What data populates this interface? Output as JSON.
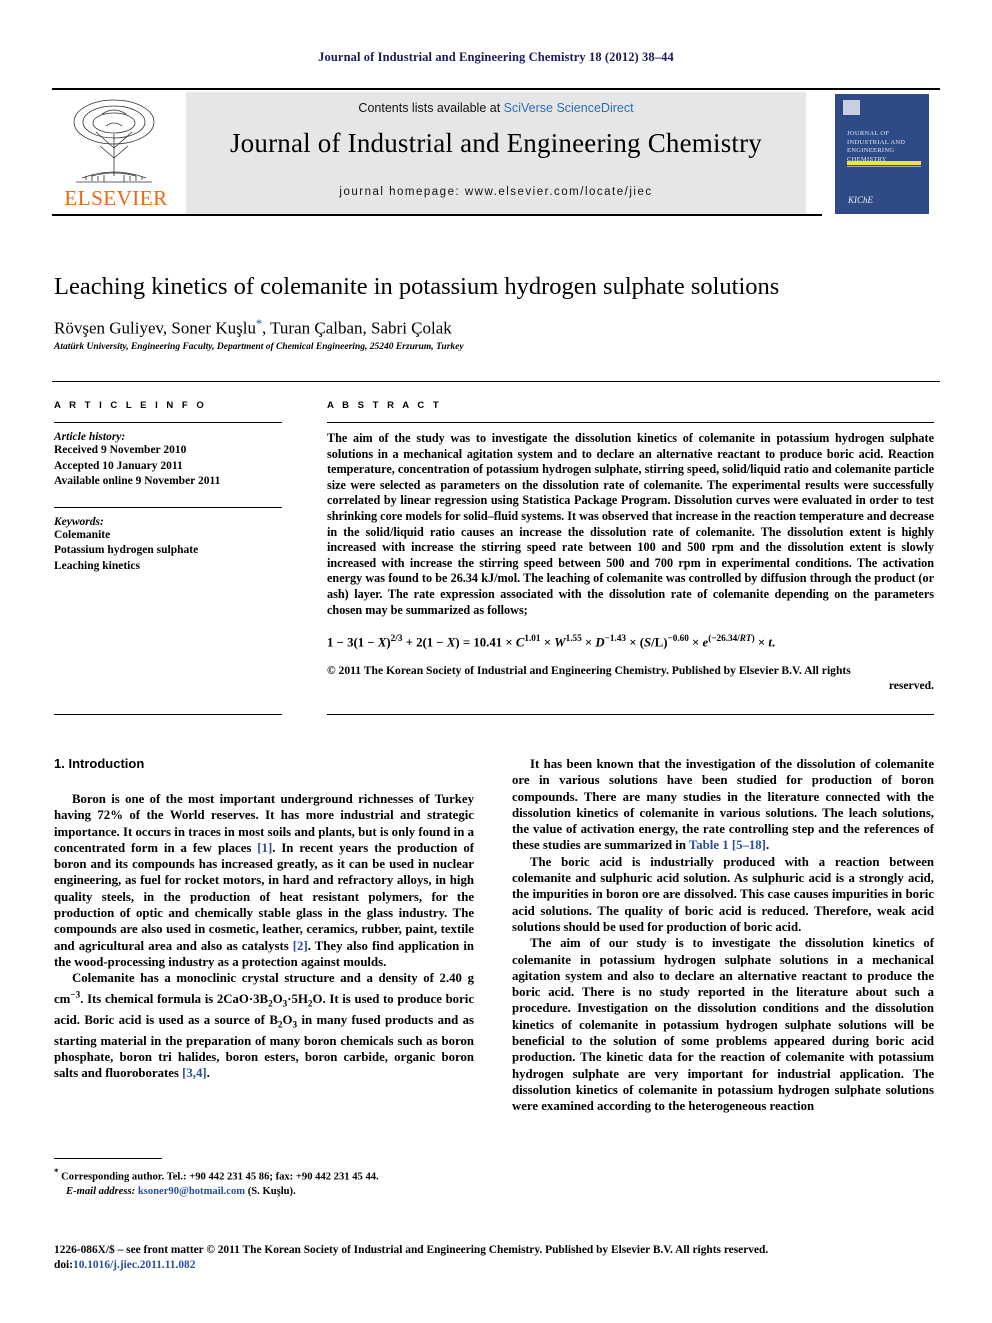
{
  "running_head": "Journal of Industrial and Engineering Chemistry 18 (2012) 38–44",
  "masthead": {
    "contents_prefix": "Contents lists available at ",
    "contents_link": "SciVerse ScienceDirect",
    "journal_name": "Journal of Industrial and Engineering Chemistry",
    "homepage": "journal homepage: www.elsevier.com/locate/jiec",
    "publisher_wordmark": "ELSEVIER",
    "cover_title": "Journal of Industrial and Engineering Chemistry",
    "cover_society": "The Korean Society of Industrial and Engineering Chemistry",
    "cover_society_mark": "KIChE"
  },
  "article": {
    "title": "Leaching kinetics of colemanite in potassium hydrogen sulphate solutions",
    "authors": "Rövşen Guliyev, Soner Kuşlu",
    "authors_tail": ", Turan Çalban, Sabri Çolak",
    "corresponding_marker": "*",
    "affiliation": "Atatürk University, Engineering Faculty, Department of Chemical Engineering, 25240 Erzurum, Turkey"
  },
  "article_info": {
    "heading": "A R T I C L E   I N F O",
    "history_label": "Article history:",
    "history": [
      "Received 9 November 2010",
      "Accepted 10 January 2011",
      "Available online 9 November 2011"
    ],
    "keywords_label": "Keywords:",
    "keywords": [
      "Colemanite",
      "Potassium hydrogen sulphate",
      "Leaching kinetics"
    ]
  },
  "abstract": {
    "heading": "A B S T R A C T",
    "text": "The aim of the study was to investigate the dissolution kinetics of colemanite in potassium hydrogen sulphate solutions in a mechanical agitation system and to declare an alternative reactant to produce boric acid. Reaction temperature, concentration of potassium hydrogen sulphate, stirring speed, solid/liquid ratio and colemanite particle size were selected as parameters on the dissolution rate of colemanite. The experimental results were successfully correlated by linear regression using Statistica Package Program. Dissolution curves were evaluated in order to test shrinking core models for solid–fluid systems. It was observed that increase in the reaction temperature and decrease in the solid/liquid ratio causes an increase the dissolution rate of colemanite. The dissolution extent is highly increased with increase the stirring speed rate between 100 and 500 rpm and the dissolution extent is slowly increased with increase the stirring speed between 500 and 700 rpm in experimental conditions. The activation energy was found to be 26.34 kJ/mol. The leaching of colemanite was controlled by diffusion through the product (or ash) layer. The rate expression associated with the dissolution rate of colemanite depending on the parameters chosen may be summarized as follows;",
    "equation_plain": "1 − 3(1 − X)2/3 + 2(1 − X) = 10.41 × C1.01 × W1.55 × D−1.43 × (S/L)−0.60 × e(−26.34/RT) × t.",
    "copyright": "© 2011 The Korean Society of Industrial and Engineering Chemistry. Published by Elsevier B.V. All rights",
    "copyright_tail": "reserved."
  },
  "body": {
    "intro_heading": "1. Introduction",
    "left_paragraphs": [
      "Boron is one of the most important underground richnesses of Turkey having 72% of the World reserves. It has more industrial and strategic importance. It occurs in traces in most soils and plants, but is only found in a concentrated form in a few places [1]. In recent years the production of boron and its compounds has increased greatly, as it can be used in nuclear engineering, as fuel for rocket motors, in hard and refractory alloys, in high quality steels, in the production of heat resistant polymers, for the production of optic and chemically stable glass in the glass industry. The compounds are also used in cosmetic, leather, ceramics, rubber, paint, textile and agricultural area and also as catalysts [2]. They also find application in the wood-processing industry as a protection against moulds.",
      "Colemanite has a monoclinic crystal structure and a density of 2.40 g cm−3. Its chemical formula is 2CaO·3B2O3·5H2O. It is used to produce boric acid. Boric acid is used as a source of B2O3 in many fused products and as starting material in the preparation of many boron chemicals such as boron phosphate, boron tri halides, boron esters, boron carbide, organic boron salts and fluoroborates [3,4]."
    ],
    "right_paragraphs": [
      "It has been known that the investigation of the dissolution of colemanite ore in various solutions have been studied for production of boron compounds. There are many studies in the literature connected with the dissolution kinetics of colemanite in various solutions. The leach solutions, the value of activation energy, the rate controlling step and the references of these studies are summarized in Table 1 [5–18].",
      "The boric acid is industrially produced with a reaction between colemanite and sulphuric acid solution. As sulphuric acid is a strongly acid, the impurities in boron ore are dissolved. This case causes impurities in boric acid solutions. The quality of boric acid is reduced. Therefore, weak acid solutions should be used for production of boric acid.",
      "The aim of our study is to investigate the dissolution kinetics of colemanite in potassium hydrogen sulphate solutions in a mechanical agitation system and also to declare an alternative reactant to produce the boric acid. There is no study reported in the literature about such a procedure. Investigation on the dissolution conditions and the dissolution kinetics of colemanite in potassium hydrogen sulphate solutions will be beneficial to the solution of some problems appeared during boric acid production. The kinetic data for the reaction of colemanite with potassium hydrogen sulphate are very important for industrial application. The dissolution kinetics of colemanite in potassium hydrogen sulphate solutions were examined according to the heterogeneous reaction"
    ]
  },
  "footnote": {
    "line1": "Corresponding author. Tel.: +90 442 231 45 86; fax: +90 442 231 45 44.",
    "email_label": "E-mail address:",
    "email": "ksoner90@hotmail.com",
    "email_owner": "(S. Kuşlu)."
  },
  "page_footer": {
    "line1": "1226-086X/$ – see front matter © 2011 The Korean Society of Industrial and Engineering Chemistry. Published by Elsevier B.V. All rights reserved.",
    "doi_label": "doi:",
    "doi": "10.1016/j.jiec.2011.11.082"
  },
  "colors": {
    "running_head": "#1b1b5c",
    "link": "#2a4d9b",
    "sciencedirect_link": "#2a6ebb",
    "elsevier_orange": "#e86a10",
    "cover_blue": "#2e4b86",
    "cover_yellow": "#f2e33c",
    "band_grey": "#e6e6e6"
  }
}
